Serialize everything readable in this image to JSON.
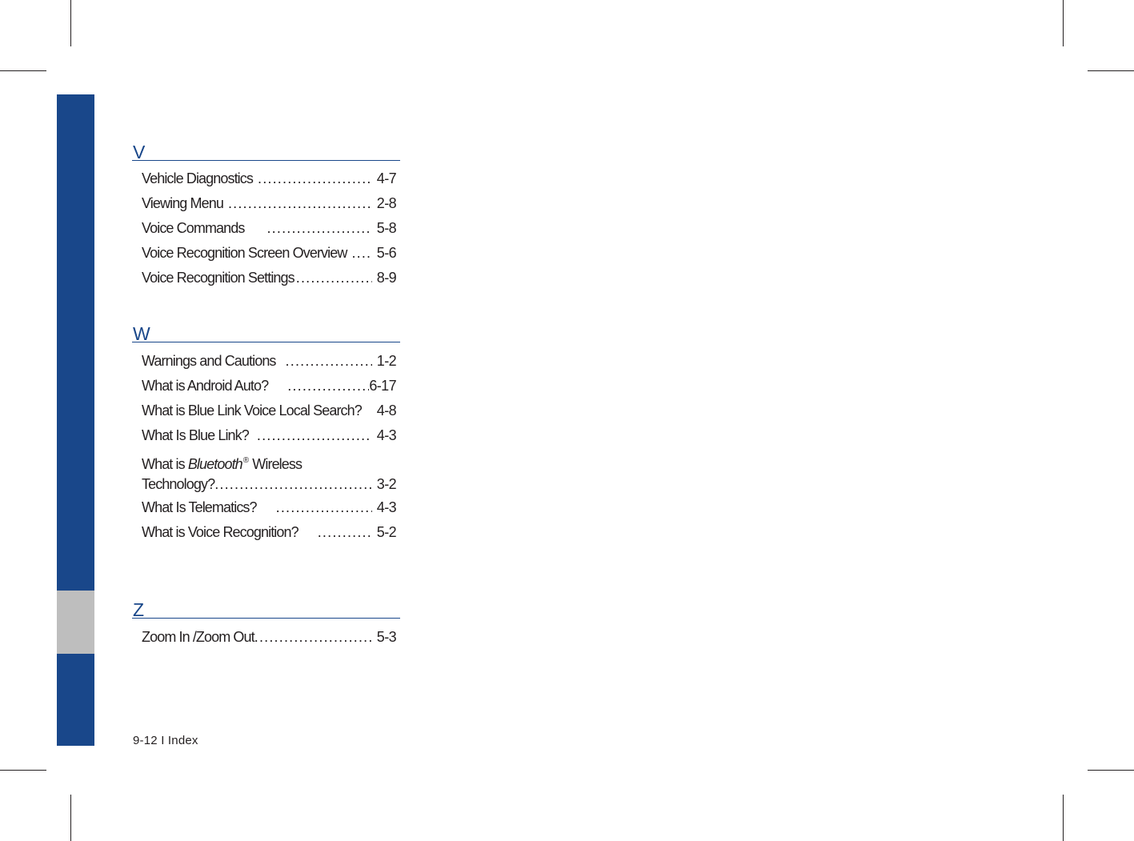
{
  "sections": [
    {
      "letter": "V",
      "entries": [
        {
          "label": "Vehicle Diagnostics",
          "page": "4-7"
        },
        {
          "label": "Viewing Menu",
          "page": "2-8"
        },
        {
          "label": "Voice Commands",
          "page": "5-8"
        },
        {
          "label": "Voice Recognition Screen Overview",
          "page": "5-6"
        },
        {
          "label": "Voice Recognition Settings",
          "page": "8-9"
        }
      ]
    },
    {
      "letter": "W",
      "entries": [
        {
          "label": "Warnings and Cautions",
          "page": "1-2"
        },
        {
          "label": "What is Android Auto?",
          "page": "6-17"
        },
        {
          "label": "What is Blue Link Voice Local Search?",
          "page": "4-8"
        },
        {
          "label": "What Is Blue Link?",
          "page": "4-3"
        },
        {
          "label_prefix": "What is",
          "label_italic": "Bluetooth",
          "label_sup": "®",
          "label_suffix": "Wireless",
          "label_line2": "Technology?",
          "page": "3-2"
        },
        {
          "label": "What Is Telematics?",
          "page": "4-3"
        },
        {
          "label": "What is Voice Recognition?",
          "page": "5-2"
        }
      ]
    },
    {
      "letter": "Z",
      "entries": [
        {
          "label": "Zoom In /Zoom Out",
          "page": "5-3"
        }
      ]
    }
  ],
  "footer": {
    "page_label": "9-12 I Index"
  },
  "colors": {
    "accent_blue": "#19478a",
    "tab_gray": "#bebebe",
    "text": "#231f20"
  }
}
